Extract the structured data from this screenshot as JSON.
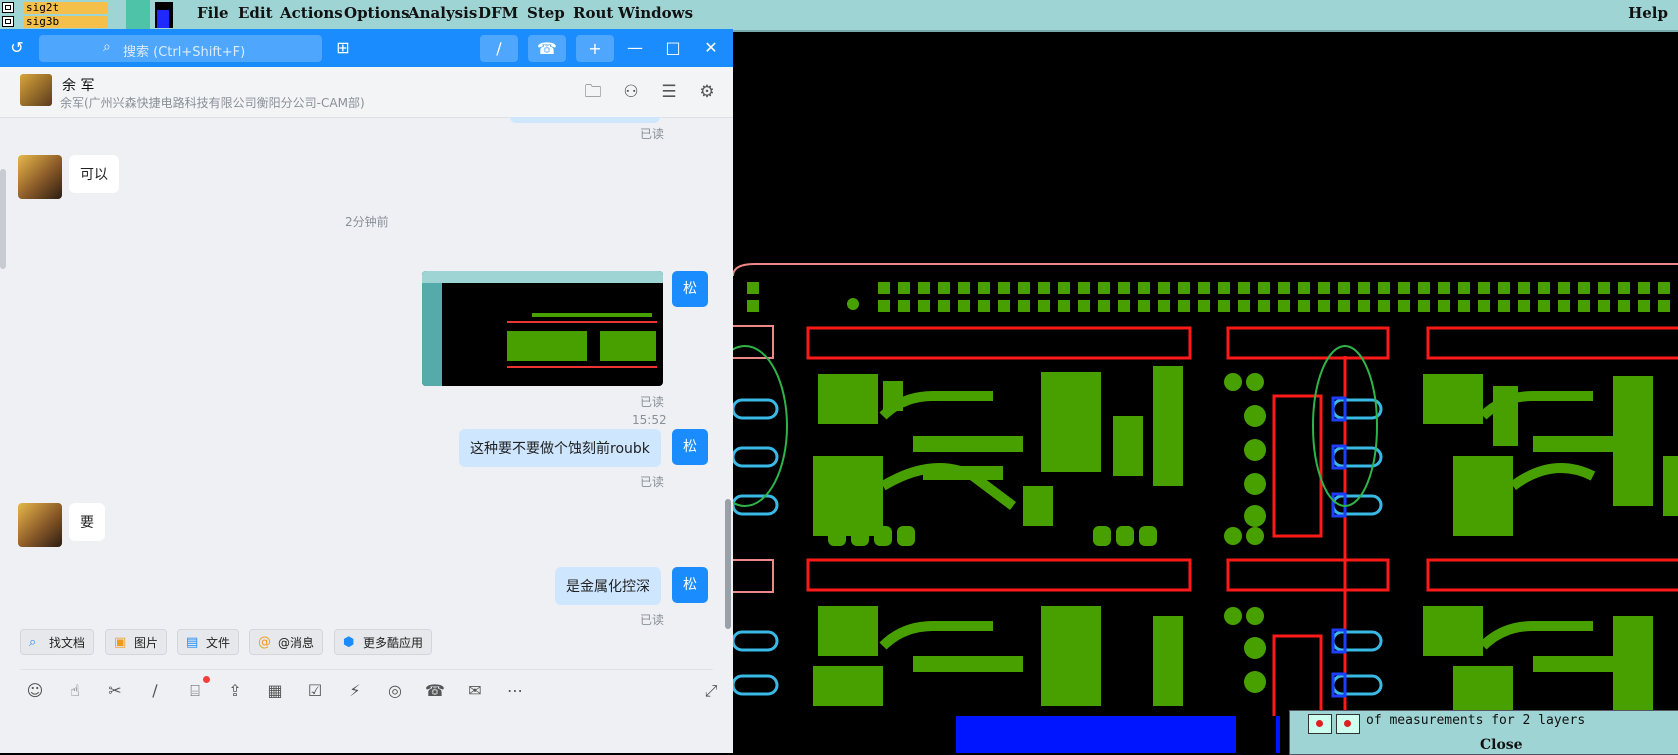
{
  "cam": {
    "layers": [
      "sig2t",
      "sig3b"
    ],
    "menu": [
      "File",
      "Edit",
      "Actions",
      "Options",
      "Analysis",
      "DFM",
      "Step",
      "Rout",
      "Windows"
    ],
    "help": "Help",
    "panel_text": "of measurements for 2 layers",
    "panel_close": "Close"
  },
  "chat": {
    "search_placeholder": "搜索 (Ctrl+Shift+F)",
    "contact_name": "余 军",
    "contact_sub": "余军(广州兴森快捷电路科技有限公司衡阳分公司-CAM部)",
    "messages": {
      "read_1": "已读",
      "in_1": "可以",
      "time_1": "2分钟前",
      "self_avatar": "松",
      "read_2": "已读",
      "time_2": "15:52",
      "out_2": "这种要不要做个蚀刻前roubk",
      "read_3": "已读",
      "in_2": "要",
      "out_3": "是金属化控深",
      "read_4": "已读"
    },
    "quick_actions": [
      "找文档",
      "图片",
      "文件",
      "@消息",
      "更多酷应用"
    ]
  },
  "colors": {
    "chat_accent": "#1a8cfe",
    "pcb_copper": "#48a000",
    "pcb_outline": "#ff1a1a",
    "cam_menubar": "#9fd4d4"
  },
  "icons": {
    "topbar": [
      "history-icon",
      "search-icon",
      "apps-icon",
      "magic-wand-icon",
      "call-icon",
      "plus-icon",
      "minimize-icon",
      "maximize-icon",
      "close-icon"
    ],
    "header": [
      "folder-icon",
      "add-member-icon",
      "search-history-icon",
      "settings-icon"
    ],
    "toolbar": [
      "emoji-icon",
      "like-icon",
      "scissors-icon",
      "slash-command-icon",
      "doc-plus-icon",
      "upload-icon",
      "calendar-icon",
      "todo-icon",
      "lightning-icon",
      "share-screen-icon",
      "voice-call-icon",
      "mail-icon",
      "more-icon",
      "expand-icon"
    ]
  }
}
